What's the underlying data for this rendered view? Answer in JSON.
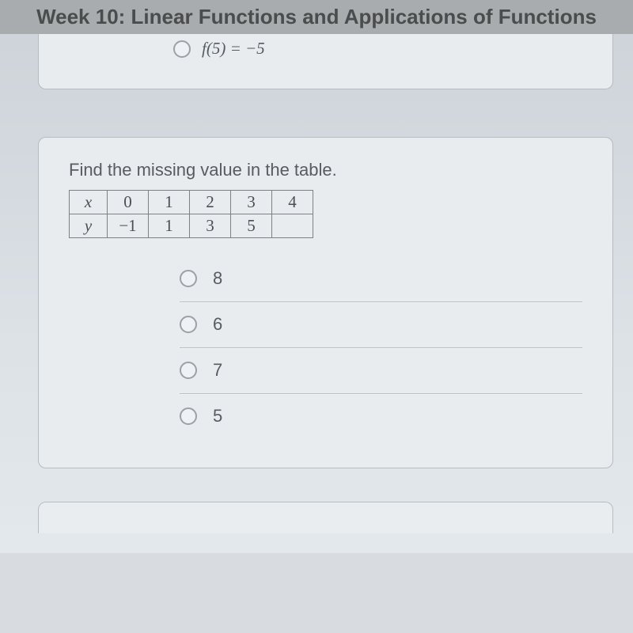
{
  "header": {
    "title": "Week 10: Linear Functions and Applications of Functions"
  },
  "prev_card": {
    "partial_option": "f(5) = −5"
  },
  "question": {
    "prompt": "Find the missing value in the table.",
    "table": {
      "row_x_label": "x",
      "row_y_label": "y",
      "x_values": [
        "0",
        "1",
        "2",
        "3",
        "4"
      ],
      "y_values": [
        "−1",
        "1",
        "3",
        "5",
        ""
      ]
    },
    "options": [
      "8",
      "6",
      "7",
      "5"
    ]
  }
}
